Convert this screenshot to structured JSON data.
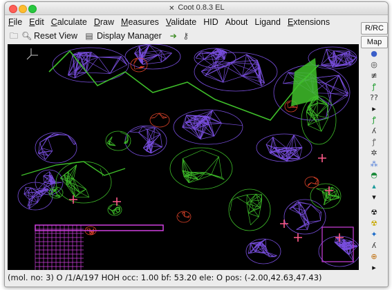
{
  "window": {
    "title": "Coot 0.8.3 EL"
  },
  "menus": [
    {
      "underline": "F",
      "rest": "ile"
    },
    {
      "underline": "E",
      "rest": "dit"
    },
    {
      "underline": "C",
      "rest": "alculate"
    },
    {
      "underline": "D",
      "rest": "raw"
    },
    {
      "underline": "M",
      "rest": "easures"
    },
    {
      "underline": "V",
      "rest": "alidate"
    },
    {
      "underline": "",
      "rest": "HID"
    },
    {
      "underline": "",
      "rest": "About"
    },
    {
      "underline": "",
      "rest": "Ligand"
    },
    {
      "underline": "E",
      "rest": "xtensions"
    }
  ],
  "toolbar": {
    "reset_view_label": "Reset View",
    "display_manager_label": "Display Manager"
  },
  "right_panel": {
    "rrc_label": "R/RC",
    "map_label": "Map",
    "tools": [
      {
        "name": "sphere-refine-icon",
        "glyph": "●",
        "color": "#3b5fc9"
      },
      {
        "name": "rotate-icon",
        "glyph": "◎",
        "color": "#333333"
      },
      {
        "name": "rotamer-icon",
        "glyph": "≢",
        "color": "#333333"
      },
      {
        "name": "flip-peptide-icon",
        "glyph": "ꝭ",
        "color": "#1a9a2a"
      },
      {
        "name": "unknown-icon",
        "glyph": "??",
        "color": "#333333"
      },
      {
        "name": "arrow-right-icon",
        "glyph": "▸",
        "color": "#111111"
      },
      {
        "name": "add-atom-icon",
        "glyph": "ꝭ",
        "color": "#1a9a2a"
      },
      {
        "name": "mutate-icon",
        "glyph": "ʎ",
        "color": "#333333"
      },
      {
        "name": "auto-fit-icon",
        "glyph": "ꝭ",
        "color": "#666666"
      },
      {
        "name": "find-waters-icon",
        "glyph": "✲",
        "color": "#333333"
      },
      {
        "name": "add-alt-conf-icon",
        "glyph": "⁂",
        "color": "#4a7ad8"
      },
      {
        "name": "clear-icon",
        "glyph": "◓",
        "color": "#1a8a3a"
      },
      {
        "name": "model-map-icon",
        "glyph": "▴",
        "color": "#1a9a9a"
      },
      {
        "name": "arrow-down-icon",
        "glyph": "▾",
        "color": "#111111"
      },
      {
        "name": "radiation-icon",
        "glyph": "☢",
        "color": "#111111"
      },
      {
        "name": "warning-icon",
        "glyph": "☢",
        "color": "#c8a800"
      },
      {
        "name": "sparkle-icon",
        "glyph": "✦",
        "color": "#1a6ac8"
      },
      {
        "name": "ligand-icon",
        "glyph": "ʎ",
        "color": "#333333"
      },
      {
        "name": "delete-icon",
        "glyph": "⊕",
        "color": "#c07010"
      },
      {
        "name": "more-icon",
        "glyph": "▸",
        "color": "#111111"
      }
    ]
  },
  "status_bar": {
    "text": "(mol. no: 3)  O  /1/A/197 HOH occ:  1.00 bf: 53.20 ele:  O pos: (-2.00,42.63,47.43)"
  },
  "colors": {
    "map_blue": "#7a4fe0",
    "diff_map_green": "#3fbf2a",
    "diff_map_red": "#e0442a",
    "water_pink": "#ff5a8a",
    "selected_magenta": "#d040e0",
    "background": "#000000"
  }
}
